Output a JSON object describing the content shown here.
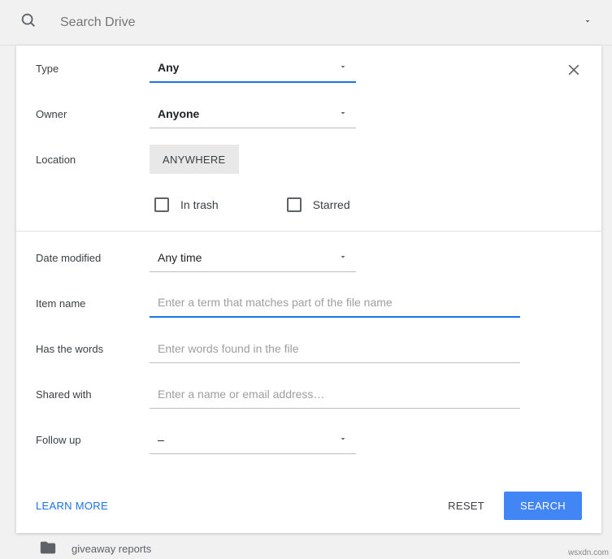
{
  "search": {
    "placeholder": "Search Drive"
  },
  "filters": {
    "type": {
      "label": "Type",
      "value": "Any"
    },
    "owner": {
      "label": "Owner",
      "value": "Anyone"
    },
    "location": {
      "label": "Location",
      "button": "ANYWHERE",
      "inTrash": "In trash",
      "starred": "Starred"
    },
    "dateModified": {
      "label": "Date modified",
      "value": "Any time"
    },
    "itemName": {
      "label": "Item name",
      "placeholder": "Enter a term that matches part of the file name"
    },
    "hasWords": {
      "label": "Has the words",
      "placeholder": "Enter words found in the file"
    },
    "sharedWith": {
      "label": "Shared with",
      "placeholder": "Enter a name or email address…"
    },
    "followUp": {
      "label": "Follow up",
      "value": "–"
    }
  },
  "footer": {
    "learnMore": "LEARN MORE",
    "reset": "RESET",
    "search": "SEARCH"
  },
  "background": {
    "item": "giveaway reports"
  },
  "watermark": "wsxdn.com"
}
